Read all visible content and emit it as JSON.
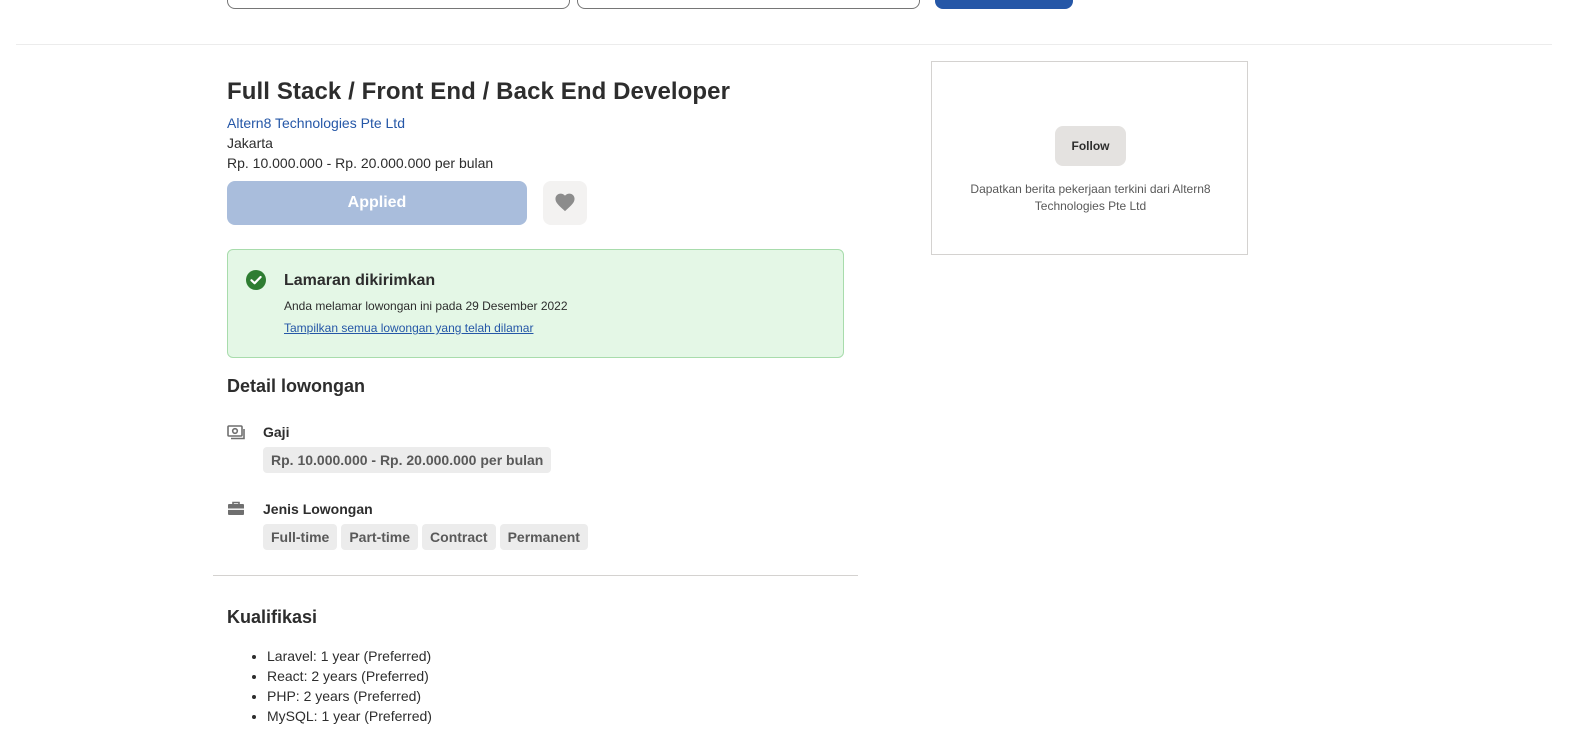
{
  "job": {
    "title": "Full Stack / Front End / Back End Developer",
    "company": "Altern8 Technologies Pte Ltd",
    "location": "Jakarta",
    "salary": "Rp. 10.000.000 - Rp. 20.000.000 per bulan",
    "applied_label": "Applied",
    "save_icon": "heart-icon"
  },
  "applied_notice": {
    "title": "Lamaran dikirimkan",
    "description": "Anda melamar lowongan ini pada 29 Desember 2022",
    "link": "Tampilkan semua lowongan yang telah dilamar",
    "icon": "check-circle-icon",
    "accent": "#2e7d32"
  },
  "details": {
    "heading": "Detail lowongan",
    "salary": {
      "label": "Gaji",
      "icon": "money-icon",
      "value": "Rp. 10.000.000 - Rp. 20.000.000 per bulan"
    },
    "job_type": {
      "label": "Jenis Lowongan",
      "icon": "briefcase-icon",
      "types": [
        "Full-time",
        "Part-time",
        "Contract",
        "Permanent"
      ]
    }
  },
  "qualifications": {
    "heading": "Kualifikasi",
    "items": [
      "Laravel: 1 year (Preferred)",
      "React: 2 years (Preferred)",
      "PHP: 2 years (Preferred)",
      "MySQL: 1 year (Preferred)"
    ]
  },
  "company_card": {
    "follow_label": "Follow",
    "description": "Dapatkan berita pekerjaan terkini dari Altern8 Technologies Pte Ltd"
  },
  "colors": {
    "brand_blue": "#2557a7",
    "applied_disabled": "#a9bddc",
    "success_bg": "#e4f7e6",
    "success_border": "#a8dcac"
  }
}
